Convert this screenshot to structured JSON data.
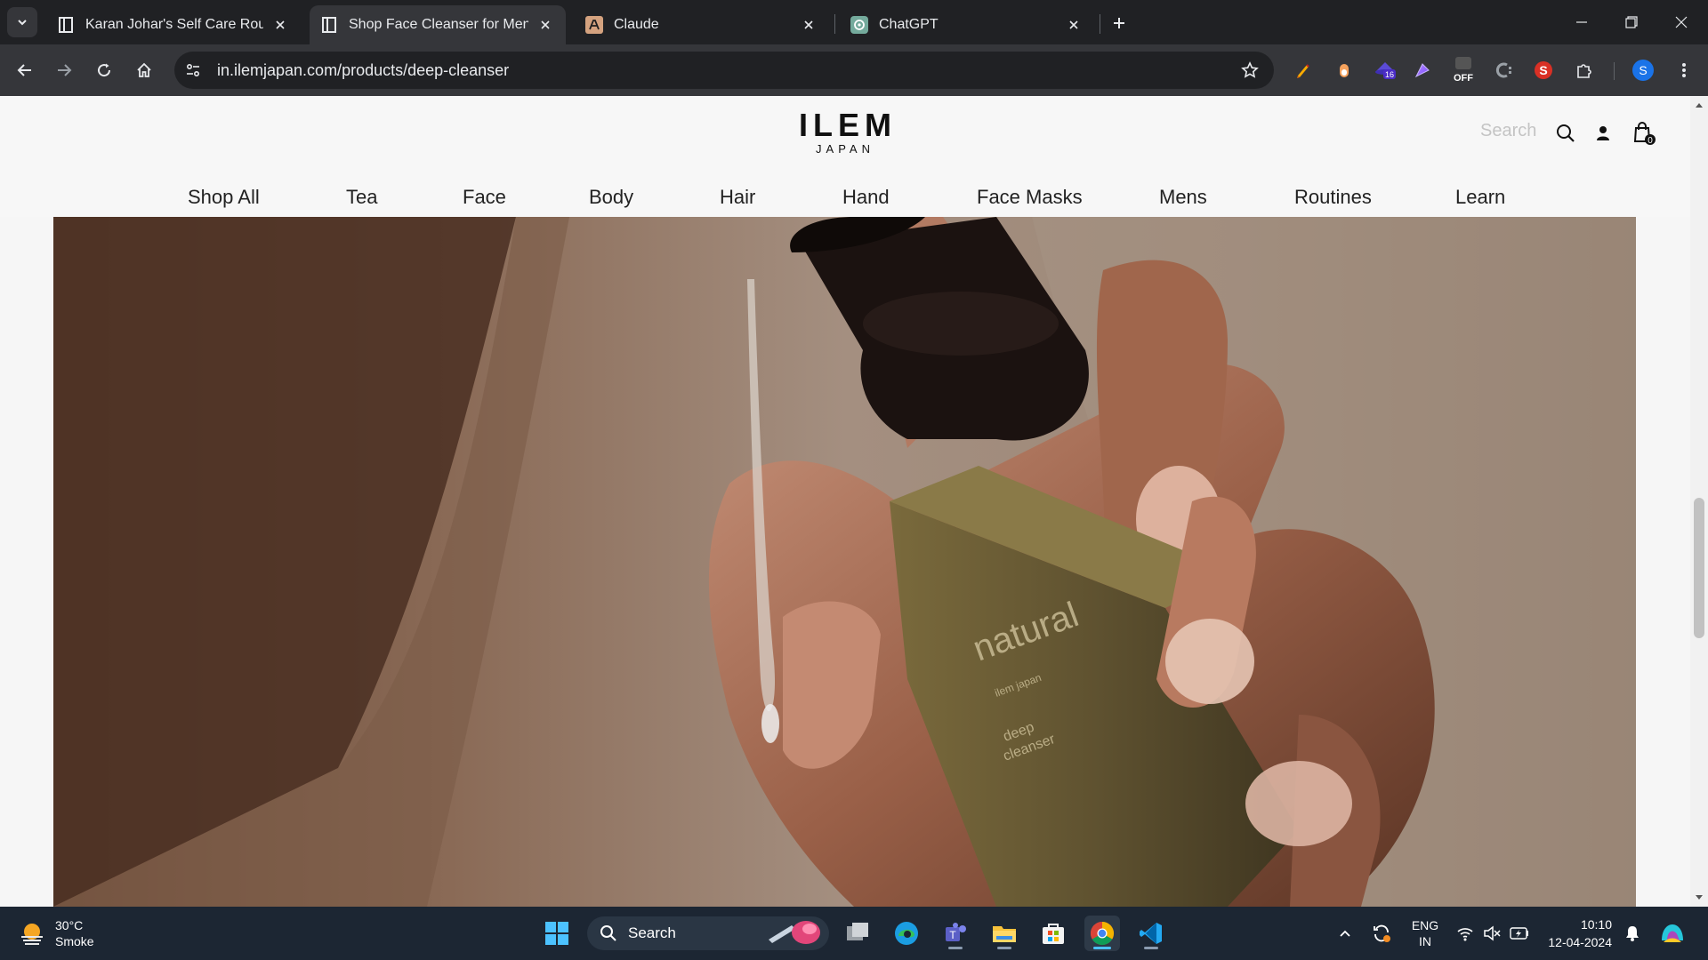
{
  "browser": {
    "tabs": [
      {
        "title": "Karan Johar's Self Care Routine",
        "favicon": "ilem-favicon",
        "active": false
      },
      {
        "title": "Shop Face Cleanser for Men On",
        "favicon": "ilem-favicon",
        "active": true
      },
      {
        "title": "Claude",
        "favicon": "anthropic-favicon",
        "active": false
      },
      {
        "title": "ChatGPT",
        "favicon": "chatgpt-favicon",
        "active": false
      }
    ],
    "url": "in.ilemjapan.com/products/deep-cleanser",
    "extensions": {
      "badge_count": "16",
      "off_label": "OFF"
    },
    "profile_initial": "S"
  },
  "site": {
    "logo": {
      "brand": "ILEM",
      "sub": "JAPAN"
    },
    "search_placeholder": "Search",
    "cart_count": "0",
    "nav": [
      "Shop All",
      "Tea",
      "Face",
      "Body",
      "Hair",
      "Hand",
      "Face Masks",
      "Mens",
      "Routines",
      "Learn"
    ],
    "hero": {
      "image": "hand-holding-cleanser-bottle",
      "bottle_label": [
        "natural",
        "ilem japan",
        "deep",
        "cleanser"
      ]
    }
  },
  "taskbar": {
    "weather": {
      "temp": "30°C",
      "condition": "Smoke"
    },
    "search_label": "Search",
    "language": {
      "lang": "ENG",
      "region": "IN"
    },
    "time": "10:10",
    "date": "12-04-2024",
    "colors": {
      "bg": "#1c2633",
      "accent": "#4cc2ff"
    }
  }
}
